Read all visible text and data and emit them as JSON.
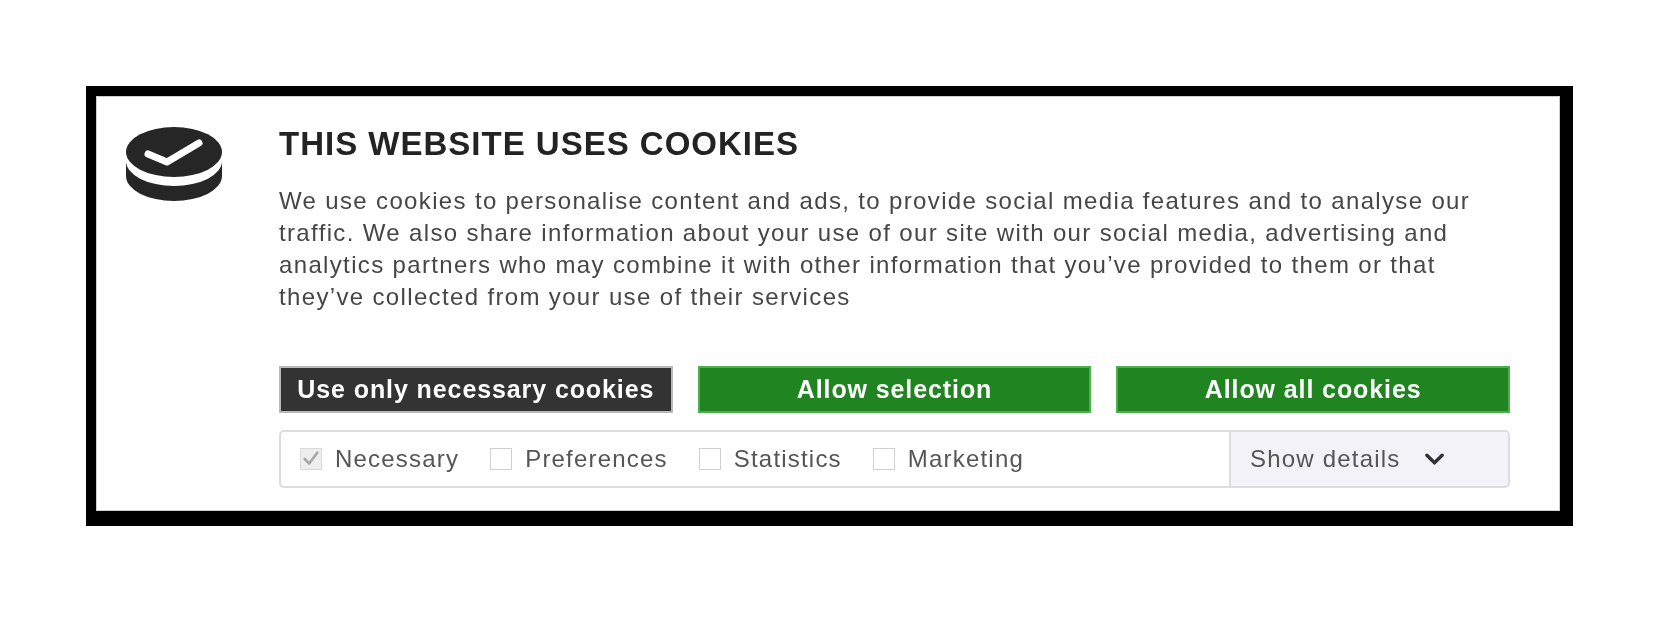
{
  "banner": {
    "title": "THIS WEBSITE USES COOKIES",
    "message": "We use cookies to personalise content and ads, to provide social media features and to analyse our traffic. We also share information about your use of our site with our social media, advertising and analytics partners who may combine it with other information that you’ve provided to them or that they’ve collected from your use of their services",
    "buttons": [
      {
        "label": "Use only necessary cookies",
        "kind": "dark"
      },
      {
        "label": "Allow selection",
        "kind": "green"
      },
      {
        "label": "Allow all cookies",
        "kind": "green"
      }
    ],
    "categories": [
      {
        "label": "Necessary",
        "checked": true,
        "disabled": true
      },
      {
        "label": "Preferences",
        "checked": false,
        "disabled": false
      },
      {
        "label": "Statistics",
        "checked": false,
        "disabled": false
      },
      {
        "label": "Marketing",
        "checked": false,
        "disabled": false
      }
    ],
    "details_toggle": {
      "label": "Show details",
      "expanded": false
    }
  }
}
